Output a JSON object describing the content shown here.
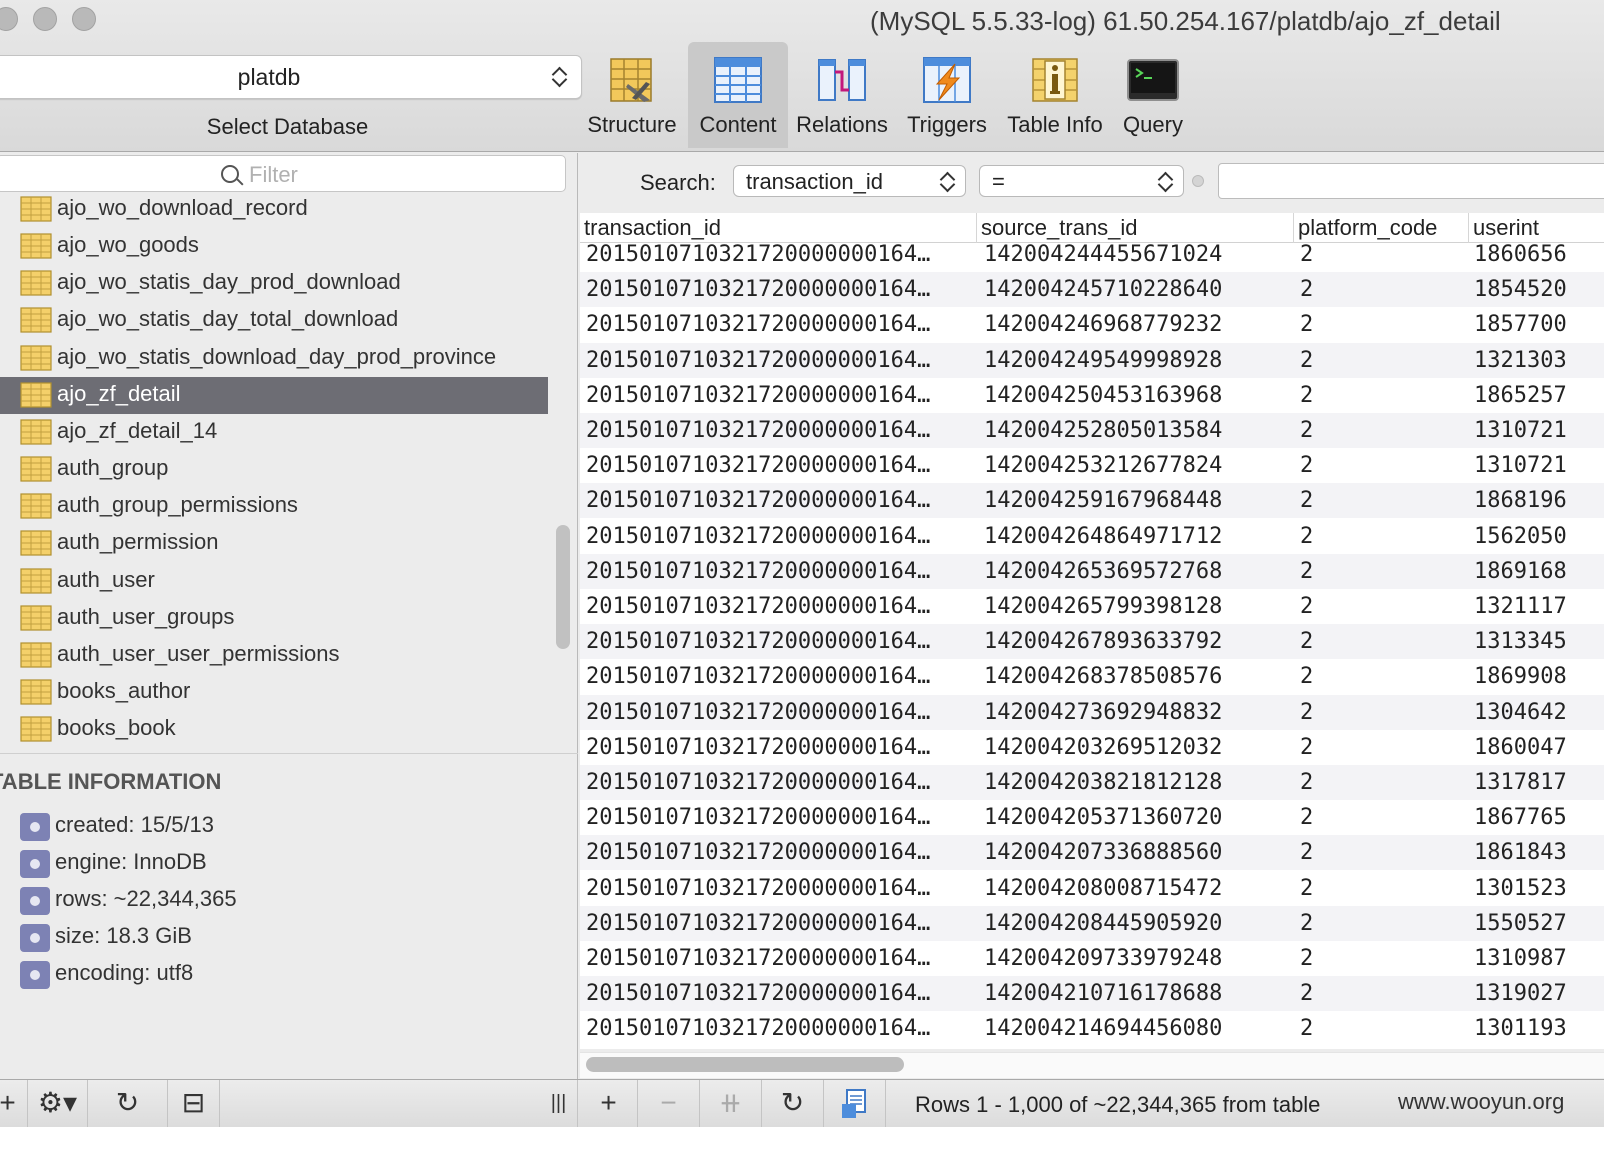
{
  "window": {
    "title": "(MySQL 5.5.33-log) 61.50.254.167/platdb/ajo_zf_detail"
  },
  "database": {
    "selected": "platdb",
    "caption": "Select Database"
  },
  "toolbar": {
    "items": [
      {
        "label": "Structure",
        "icon": "structure-icon",
        "active": false
      },
      {
        "label": "Content",
        "icon": "content-icon",
        "active": true
      },
      {
        "label": "Relations",
        "icon": "relations-icon",
        "active": false
      },
      {
        "label": "Triggers",
        "icon": "triggers-icon",
        "active": false
      },
      {
        "label": "Table Info",
        "icon": "table-info-icon",
        "active": false
      },
      {
        "label": "Query",
        "icon": "query-icon",
        "active": false
      }
    ]
  },
  "sidebar": {
    "filter_placeholder": "Filter",
    "tables": [
      "ajo_wo_download_record",
      "ajo_wo_goods",
      "ajo_wo_statis_day_prod_download",
      "ajo_wo_statis_day_total_download",
      "ajo_wo_statis_download_day_prod_province",
      "ajo_zf_detail",
      "ajo_zf_detail_14",
      "auth_group",
      "auth_group_permissions",
      "auth_permission",
      "auth_user",
      "auth_user_groups",
      "auth_user_user_permissions",
      "books_author",
      "books_book"
    ],
    "selected_table": "ajo_zf_detail",
    "table_info": {
      "heading": "TABLE INFORMATION",
      "items": [
        "created: 15/5/13",
        "engine: InnoDB",
        "rows: ~22,344,365",
        "size: 18.3 GiB",
        "encoding: utf8"
      ]
    }
  },
  "search": {
    "label": "Search:",
    "field": "transaction_id",
    "operator": "=",
    "value": ""
  },
  "grid": {
    "columns": [
      "transaction_id",
      "source_trans_id",
      "platform_code",
      "userint"
    ],
    "rows": [
      [
        "2015010710321720000000164…",
        "142004244455671024",
        "2",
        "1860656"
      ],
      [
        "2015010710321720000000164…",
        "142004245710228640",
        "2",
        "1854520"
      ],
      [
        "2015010710321720000000164…",
        "142004246968779232",
        "2",
        "1857700"
      ],
      [
        "2015010710321720000000164…",
        "142004249549998928",
        "2",
        "1321303"
      ],
      [
        "2015010710321720000000164…",
        "142004250453163968",
        "2",
        "1865257"
      ],
      [
        "2015010710321720000000164…",
        "142004252805013584",
        "2",
        "1310721"
      ],
      [
        "2015010710321720000000164…",
        "142004253212677824",
        "2",
        "1310721"
      ],
      [
        "2015010710321720000000164…",
        "142004259167968448",
        "2",
        "1868196"
      ],
      [
        "2015010710321720000000164…",
        "142004264864971712",
        "2",
        "1562050"
      ],
      [
        "2015010710321720000000164…",
        "142004265369572768",
        "2",
        "1869168"
      ],
      [
        "2015010710321720000000164…",
        "142004265799398128",
        "2",
        "1321117"
      ],
      [
        "2015010710321720000000164…",
        "142004267893633792",
        "2",
        "1313345"
      ],
      [
        "2015010710321720000000164…",
        "142004268378508576",
        "2",
        "1869908"
      ],
      [
        "2015010710321720000000164…",
        "142004273692948832",
        "2",
        "1304642"
      ],
      [
        "2015010710321720000000164…",
        "142004203269512032",
        "2",
        "1860047"
      ],
      [
        "2015010710321720000000164…",
        "142004203821812128",
        "2",
        "1317817"
      ],
      [
        "2015010710321720000000164…",
        "142004205371360720",
        "2",
        "1867765"
      ],
      [
        "2015010710321720000000164…",
        "142004207336888560",
        "2",
        "1861843"
      ],
      [
        "2015010710321720000000164…",
        "142004208008715472",
        "2",
        "1301523"
      ],
      [
        "2015010710321720000000164…",
        "142004208445905920",
        "2",
        "1550527"
      ],
      [
        "2015010710321720000000164…",
        "142004209733979248",
        "2",
        "1310987"
      ],
      [
        "2015010710321720000000164…",
        "142004210716178688",
        "2",
        "1319027"
      ],
      [
        "2015010710321720000000164…",
        "142004214694456080",
        "2",
        "1301193"
      ]
    ]
  },
  "status": {
    "rows_info": "Rows 1 - 1,000 of ~22,344,365 from table",
    "watermark": "www.wooyun.org"
  },
  "colors": {
    "selection": "#6d6d74",
    "row_stripe": "#f3f3f6",
    "info_icon": "#7d82b4"
  }
}
